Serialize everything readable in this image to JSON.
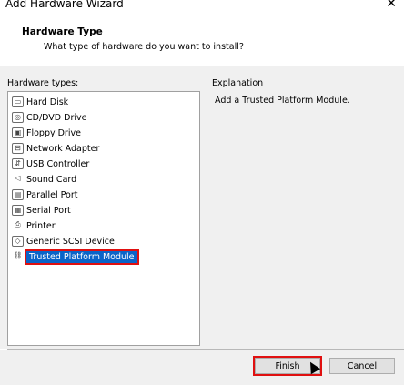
{
  "window": {
    "title": "Add Hardware Wizard",
    "close_glyph": "✕"
  },
  "header": {
    "title": "Hardware Type",
    "subtitle": "What type of hardware do you want to install?"
  },
  "hardware_list": {
    "label": "Hardware types:",
    "items": [
      {
        "label": "Hard Disk",
        "icon": "hard-disk-icon",
        "glyph": "▭"
      },
      {
        "label": "CD/DVD Drive",
        "icon": "cd-dvd-icon",
        "glyph": "◎"
      },
      {
        "label": "Floppy Drive",
        "icon": "floppy-icon",
        "glyph": "▣"
      },
      {
        "label": "Network Adapter",
        "icon": "network-icon",
        "glyph": "⊟"
      },
      {
        "label": "USB Controller",
        "icon": "usb-icon",
        "glyph": "⇵"
      },
      {
        "label": "Sound Card",
        "icon": "speaker-icon",
        "glyph": "◁"
      },
      {
        "label": "Parallel Port",
        "icon": "parallel-port-icon",
        "glyph": "▤"
      },
      {
        "label": "Serial Port",
        "icon": "serial-port-icon",
        "glyph": "▦"
      },
      {
        "label": "Printer",
        "icon": "printer-icon",
        "glyph": "⎙"
      },
      {
        "label": "Generic SCSI Device",
        "icon": "scsi-icon",
        "glyph": "◇"
      },
      {
        "label": "Trusted Platform Module",
        "icon": "tpm-icon",
        "glyph": "⛓"
      }
    ],
    "selected_index": 10
  },
  "explanation": {
    "label": "Explanation",
    "text": "Add a Trusted Platform Module."
  },
  "buttons": {
    "finish": "Finish",
    "cancel": "Cancel"
  }
}
